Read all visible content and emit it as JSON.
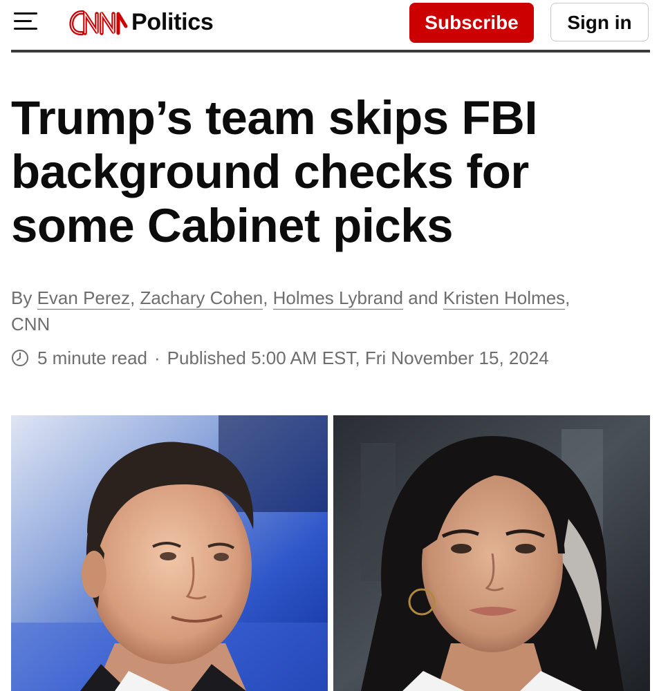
{
  "header": {
    "menu_icon": "hamburger-menu-icon",
    "brand_logo_text": "CNN",
    "section": "Politics",
    "subscribe_label": "Subscribe",
    "signin_label": "Sign in"
  },
  "article": {
    "headline": "Trump’s team skips FBI background checks for some Cabinet picks",
    "byline": {
      "prefix": "By",
      "authors": [
        "Evan Perez",
        "Zachary Cohen",
        "Holmes Lybrand",
        "Kristen Holmes"
      ],
      "and": "and",
      "outlet": "CNN"
    },
    "clock_icon": "clock-icon",
    "read_time": "5 minute read",
    "separator": "·",
    "published": "Published 5:00 AM EST, Fri November 15, 2024"
  },
  "photos": [
    {
      "description_icon": "man-portrait-photo"
    },
    {
      "description_icon": "woman-portrait-photo"
    }
  ],
  "colors": {
    "brand_red": "#cc0000",
    "text": "#0c0c0c",
    "muted": "#6e6e6e",
    "rule": "#3a3a3a"
  }
}
